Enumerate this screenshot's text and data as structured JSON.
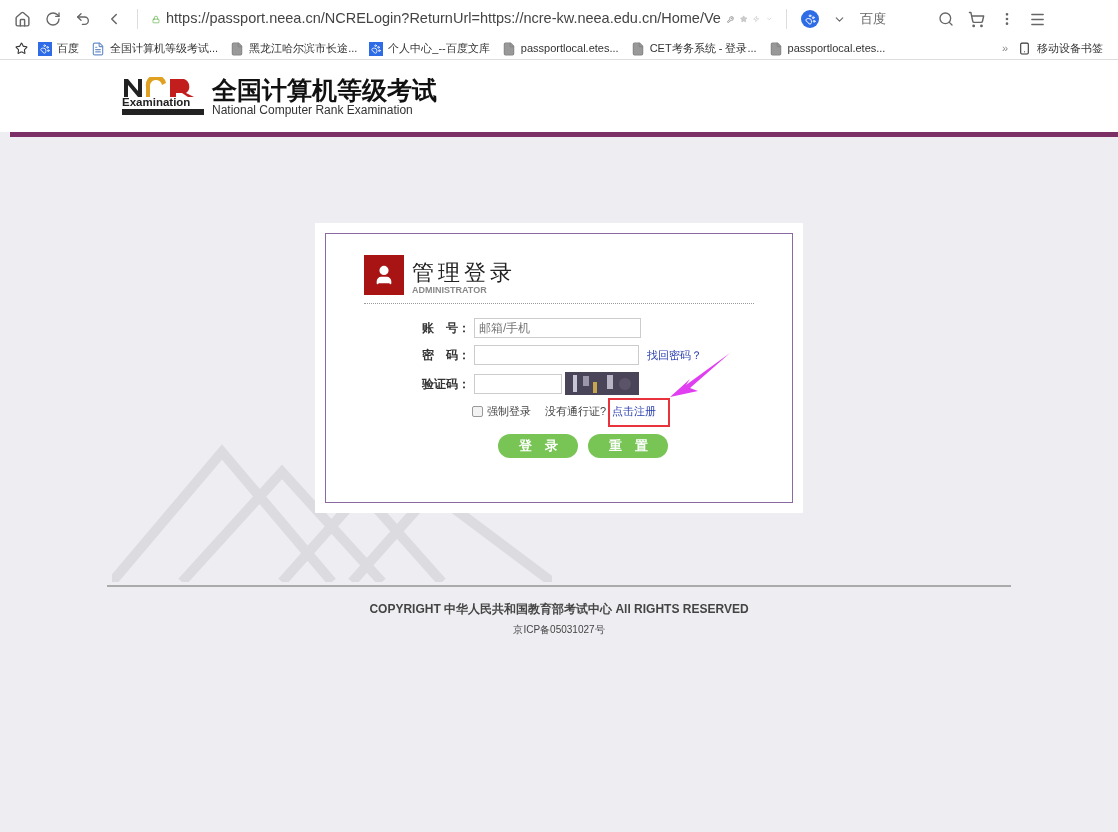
{
  "browser": {
    "url": "https://passport.neea.cn/NCRELogin?ReturnUrl=https://ncre-kw.neea.edu.cn/Home/Ve",
    "search_engine": "百度",
    "bookmarks": [
      {
        "label": "百度",
        "kind": "paw"
      },
      {
        "label": "全国计算机等级考试...",
        "kind": "page"
      },
      {
        "label": "黑龙江哈尔滨市长途...",
        "kind": "file"
      },
      {
        "label": "个人中心_--百度文库",
        "kind": "paw"
      },
      {
        "label": "passportlocal.etes...",
        "kind": "file"
      },
      {
        "label": "CET考务系统 - 登录...",
        "kind": "file"
      },
      {
        "label": "passportlocal.etes...",
        "kind": "file"
      }
    ],
    "overflow": "»",
    "mobile_bookmarks": "移动设备书签"
  },
  "header": {
    "logo_word": "Examination",
    "title": "全国计算机等级考试",
    "subtitle": "National Computer Rank Examination"
  },
  "login": {
    "title": "管理登录",
    "subtitle": "ADMINISTRATOR",
    "fields": [
      {
        "label": "账　号：",
        "kind": "text",
        "placeholder": "邮箱/手机"
      },
      {
        "label": "密　码：",
        "kind": "password",
        "link": "找回密码？"
      },
      {
        "label": "验证码：",
        "kind": "captcha"
      }
    ],
    "force_login": {
      "label": "强制登录",
      "checked": false
    },
    "register_prompt": "没有通行证?",
    "register_link": "点击注册",
    "buttons": [
      "登　录",
      "重　置"
    ]
  },
  "footer": {
    "copyright": "COPYRIGHT 中华人民共和国教育部考试中心 All RIGHTS RESERVED",
    "icp": "京ICP备05031027号"
  }
}
